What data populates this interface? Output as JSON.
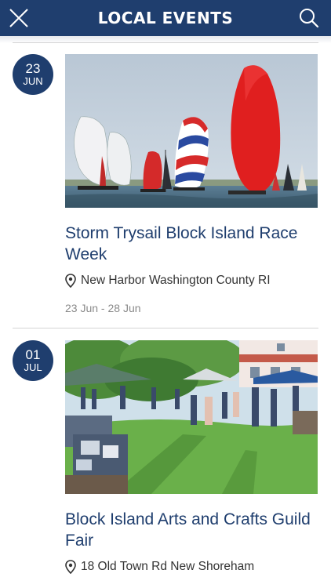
{
  "header": {
    "title": "LOCAL EVENTS",
    "icons": {
      "close": "close-icon",
      "search": "search-icon"
    },
    "background": "#1f3e6e"
  },
  "events": [
    {
      "day": "23",
      "month": "JUN",
      "title": "Storm Trysail Block Island Race Week",
      "location": "New Harbor Washington County RI",
      "dates": "23 Jun - 28 Jun",
      "image": "sailboats-image"
    },
    {
      "day": "01",
      "month": "JUL",
      "title": "Block Island Arts and Crafts Guild Fair",
      "location": "18 Old Town Rd New Shoreham",
      "image": "crafts-fair-image"
    }
  ],
  "colors": {
    "accent": "#1f3e6e",
    "date_text": "#8a8a8a"
  }
}
